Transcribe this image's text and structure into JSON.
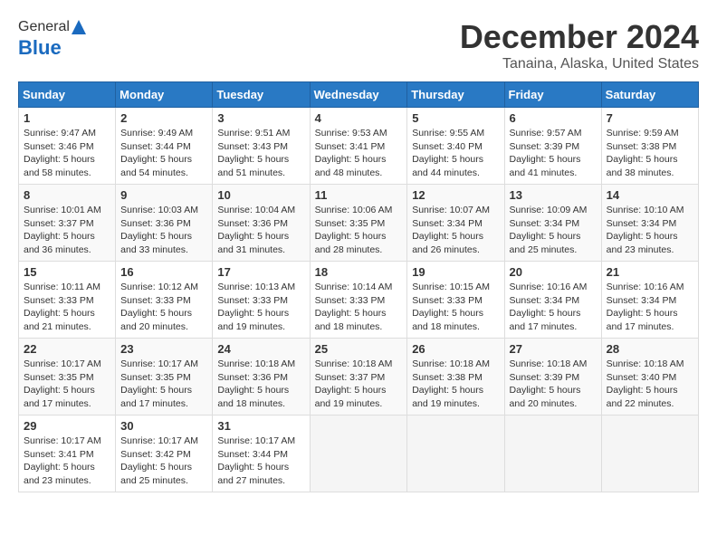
{
  "header": {
    "logo_general": "General",
    "logo_blue": "Blue",
    "month": "December 2024",
    "location": "Tanaina, Alaska, United States"
  },
  "days_of_week": [
    "Sunday",
    "Monday",
    "Tuesday",
    "Wednesday",
    "Thursday",
    "Friday",
    "Saturday"
  ],
  "weeks": [
    [
      {
        "day": 1,
        "info": "Sunrise: 9:47 AM\nSunset: 3:46 PM\nDaylight: 5 hours\nand 58 minutes."
      },
      {
        "day": 2,
        "info": "Sunrise: 9:49 AM\nSunset: 3:44 PM\nDaylight: 5 hours\nand 54 minutes."
      },
      {
        "day": 3,
        "info": "Sunrise: 9:51 AM\nSunset: 3:43 PM\nDaylight: 5 hours\nand 51 minutes."
      },
      {
        "day": 4,
        "info": "Sunrise: 9:53 AM\nSunset: 3:41 PM\nDaylight: 5 hours\nand 48 minutes."
      },
      {
        "day": 5,
        "info": "Sunrise: 9:55 AM\nSunset: 3:40 PM\nDaylight: 5 hours\nand 44 minutes."
      },
      {
        "day": 6,
        "info": "Sunrise: 9:57 AM\nSunset: 3:39 PM\nDaylight: 5 hours\nand 41 minutes."
      },
      {
        "day": 7,
        "info": "Sunrise: 9:59 AM\nSunset: 3:38 PM\nDaylight: 5 hours\nand 38 minutes."
      }
    ],
    [
      {
        "day": 8,
        "info": "Sunrise: 10:01 AM\nSunset: 3:37 PM\nDaylight: 5 hours\nand 36 minutes."
      },
      {
        "day": 9,
        "info": "Sunrise: 10:03 AM\nSunset: 3:36 PM\nDaylight: 5 hours\nand 33 minutes."
      },
      {
        "day": 10,
        "info": "Sunrise: 10:04 AM\nSunset: 3:36 PM\nDaylight: 5 hours\nand 31 minutes."
      },
      {
        "day": 11,
        "info": "Sunrise: 10:06 AM\nSunset: 3:35 PM\nDaylight: 5 hours\nand 28 minutes."
      },
      {
        "day": 12,
        "info": "Sunrise: 10:07 AM\nSunset: 3:34 PM\nDaylight: 5 hours\nand 26 minutes."
      },
      {
        "day": 13,
        "info": "Sunrise: 10:09 AM\nSunset: 3:34 PM\nDaylight: 5 hours\nand 25 minutes."
      },
      {
        "day": 14,
        "info": "Sunrise: 10:10 AM\nSunset: 3:34 PM\nDaylight: 5 hours\nand 23 minutes."
      }
    ],
    [
      {
        "day": 15,
        "info": "Sunrise: 10:11 AM\nSunset: 3:33 PM\nDaylight: 5 hours\nand 21 minutes."
      },
      {
        "day": 16,
        "info": "Sunrise: 10:12 AM\nSunset: 3:33 PM\nDaylight: 5 hours\nand 20 minutes."
      },
      {
        "day": 17,
        "info": "Sunrise: 10:13 AM\nSunset: 3:33 PM\nDaylight: 5 hours\nand 19 minutes."
      },
      {
        "day": 18,
        "info": "Sunrise: 10:14 AM\nSunset: 3:33 PM\nDaylight: 5 hours\nand 18 minutes."
      },
      {
        "day": 19,
        "info": "Sunrise: 10:15 AM\nSunset: 3:33 PM\nDaylight: 5 hours\nand 18 minutes."
      },
      {
        "day": 20,
        "info": "Sunrise: 10:16 AM\nSunset: 3:34 PM\nDaylight: 5 hours\nand 17 minutes."
      },
      {
        "day": 21,
        "info": "Sunrise: 10:16 AM\nSunset: 3:34 PM\nDaylight: 5 hours\nand 17 minutes."
      }
    ],
    [
      {
        "day": 22,
        "info": "Sunrise: 10:17 AM\nSunset: 3:35 PM\nDaylight: 5 hours\nand 17 minutes."
      },
      {
        "day": 23,
        "info": "Sunrise: 10:17 AM\nSunset: 3:35 PM\nDaylight: 5 hours\nand 17 minutes."
      },
      {
        "day": 24,
        "info": "Sunrise: 10:18 AM\nSunset: 3:36 PM\nDaylight: 5 hours\nand 18 minutes."
      },
      {
        "day": 25,
        "info": "Sunrise: 10:18 AM\nSunset: 3:37 PM\nDaylight: 5 hours\nand 19 minutes."
      },
      {
        "day": 26,
        "info": "Sunrise: 10:18 AM\nSunset: 3:38 PM\nDaylight: 5 hours\nand 19 minutes."
      },
      {
        "day": 27,
        "info": "Sunrise: 10:18 AM\nSunset: 3:39 PM\nDaylight: 5 hours\nand 20 minutes."
      },
      {
        "day": 28,
        "info": "Sunrise: 10:18 AM\nSunset: 3:40 PM\nDaylight: 5 hours\nand 22 minutes."
      }
    ],
    [
      {
        "day": 29,
        "info": "Sunrise: 10:17 AM\nSunset: 3:41 PM\nDaylight: 5 hours\nand 23 minutes."
      },
      {
        "day": 30,
        "info": "Sunrise: 10:17 AM\nSunset: 3:42 PM\nDaylight: 5 hours\nand 25 minutes."
      },
      {
        "day": 31,
        "info": "Sunrise: 10:17 AM\nSunset: 3:44 PM\nDaylight: 5 hours\nand 27 minutes."
      },
      null,
      null,
      null,
      null
    ]
  ]
}
